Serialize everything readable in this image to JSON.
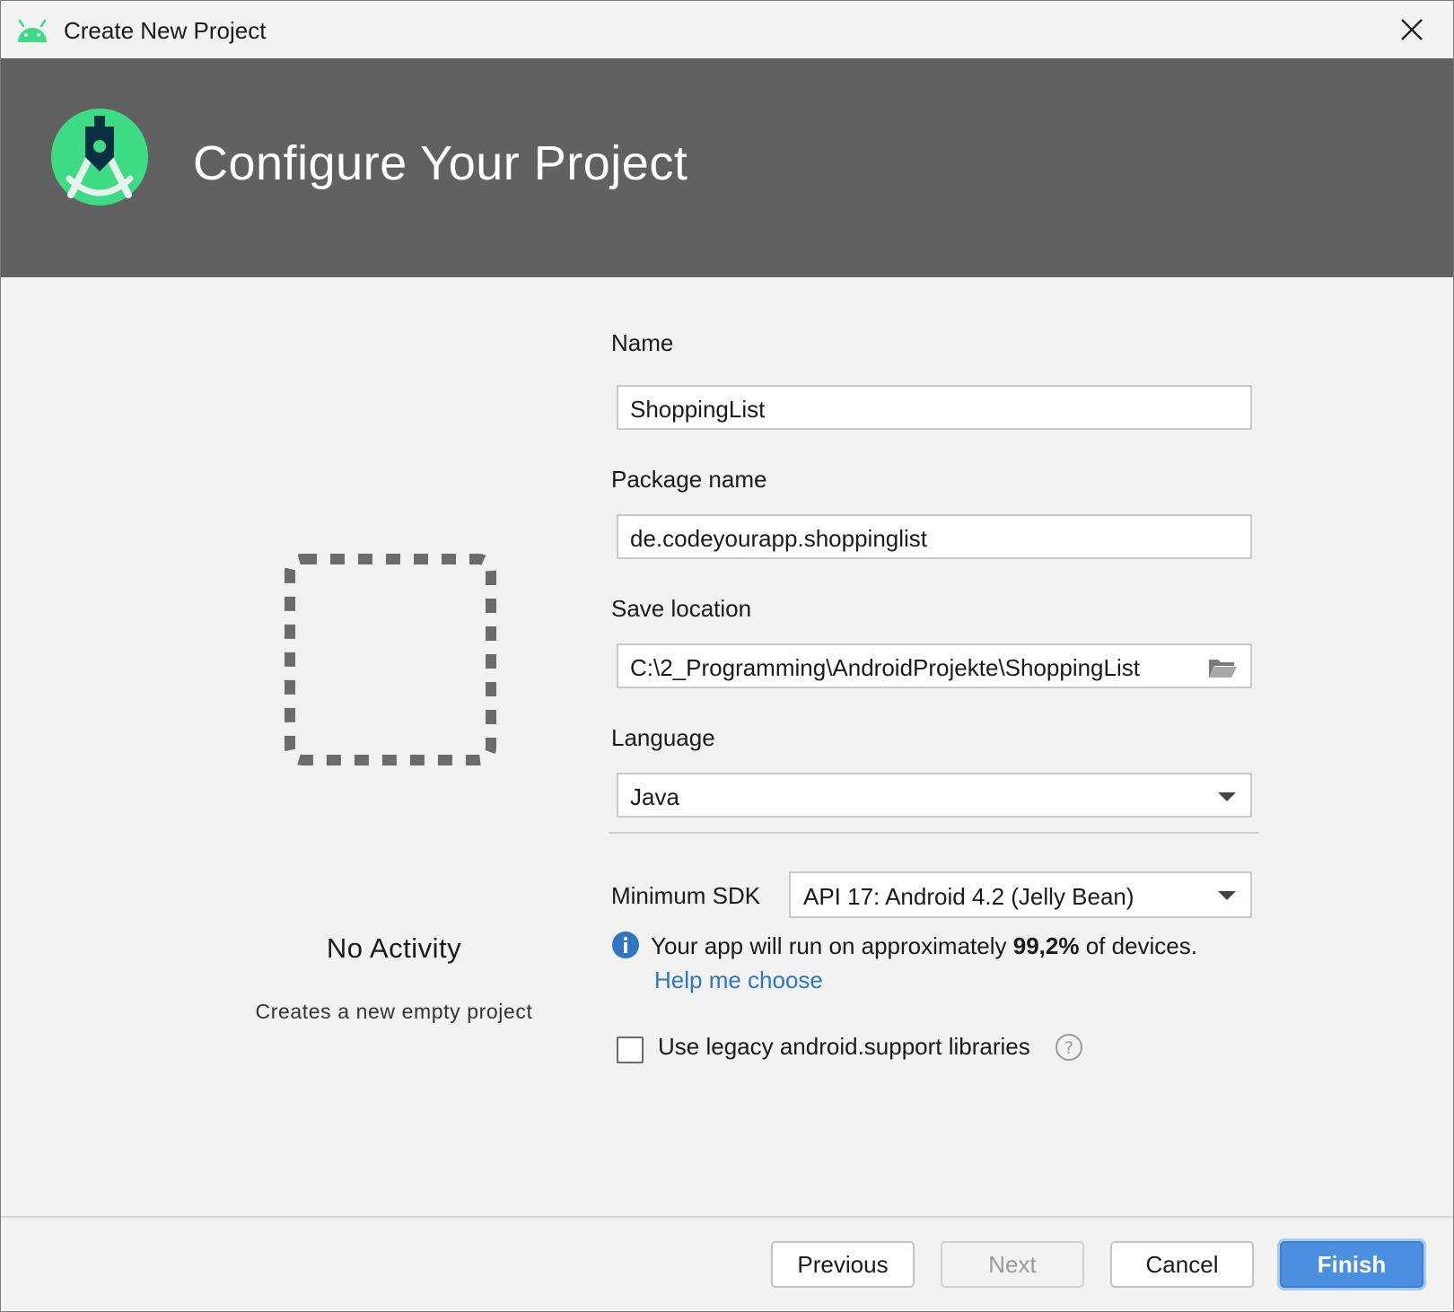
{
  "window": {
    "title": "Create New Project",
    "icon": "android-icon",
    "close_icon": "close-icon"
  },
  "header": {
    "title": "Configure Your Project",
    "logo": "android-studio-logo"
  },
  "activity": {
    "name": "No Activity",
    "description": "Creates a new empty project"
  },
  "form": {
    "name_label": "Name",
    "name_value": "ShoppingList",
    "package_label": "Package name",
    "package_value": "de.codeyourapp.shoppinglist",
    "location_label": "Save location",
    "location_value": "C:\\2_Programming\\AndroidProjekte\\ShoppingList",
    "language_label": "Language",
    "language_value": "Java",
    "min_sdk_label": "Minimum SDK",
    "min_sdk_value": "API 17: Android 4.2 (Jelly Bean)",
    "info_prefix": "Your app will run on approximately",
    "info_percent": "99,2%",
    "info_suffix": "of devices.",
    "help_link": "Help me choose",
    "legacy_label": "Use legacy android.support libraries",
    "legacy_checked": false
  },
  "buttons": {
    "previous": "Previous",
    "next": "Next",
    "cancel": "Cancel",
    "finish": "Finish"
  },
  "colors": {
    "header_bg": "#616161",
    "android_green": "#3ddc84",
    "link": "#2c76c2",
    "primary_button": "#4a8fe0"
  }
}
